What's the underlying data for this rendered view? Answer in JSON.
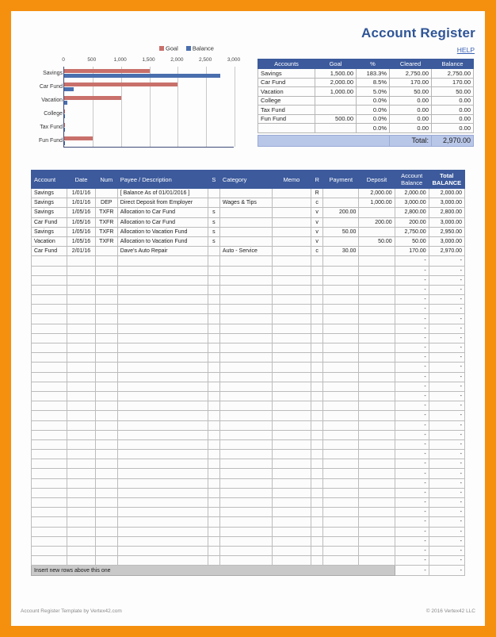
{
  "header": {
    "title": "Account Register",
    "help_label": "HELP",
    "accent": "#2f5597",
    "border_color": "#f5900f"
  },
  "chart_data": {
    "type": "bar",
    "orientation": "horizontal",
    "title": "",
    "xlabel": "",
    "ylabel": "",
    "categories": [
      "Savings",
      "Car Fund",
      "Vacation",
      "College",
      "Tax Fund",
      "Fun Fund"
    ],
    "series": [
      {
        "name": "Goal",
        "color": "#c9706b",
        "values": [
          1500,
          2000,
          1000,
          0,
          0,
          500
        ]
      },
      {
        "name": "Balance",
        "color": "#4a6fae",
        "values": [
          2750,
          170,
          50,
          0,
          0,
          0
        ]
      }
    ],
    "xlim": [
      0,
      3000
    ],
    "ticks": [
      "0",
      "500",
      "1,000",
      "1,500",
      "2,000",
      "2,500",
      "3,000"
    ],
    "tick_values": [
      0,
      500,
      1000,
      1500,
      2000,
      2500,
      3000
    ],
    "grid": true,
    "legend_position": "top-right"
  },
  "summary": {
    "columns": [
      "Accounts",
      "Goal",
      "%",
      "Cleared",
      "Balance"
    ],
    "rows": [
      {
        "account": "Savings",
        "goal": "1,500.00",
        "pct": "183.3%",
        "cleared": "2,750.00",
        "balance": "2,750.00"
      },
      {
        "account": "Car Fund",
        "goal": "2,000.00",
        "pct": "8.5%",
        "cleared": "170.00",
        "balance": "170.00"
      },
      {
        "account": "Vacation",
        "goal": "1,000.00",
        "pct": "5.0%",
        "cleared": "50.00",
        "balance": "50.00"
      },
      {
        "account": "College",
        "goal": "",
        "pct": "0.0%",
        "cleared": "0.00",
        "balance": "0.00"
      },
      {
        "account": "Tax Fund",
        "goal": "",
        "pct": "0.0%",
        "cleared": "0.00",
        "balance": "0.00"
      },
      {
        "account": "Fun Fund",
        "goal": "500.00",
        "pct": "0.0%",
        "cleared": "0.00",
        "balance": "0.00"
      },
      {
        "account": "",
        "goal": "",
        "pct": "0.0%",
        "cleared": "0.00",
        "balance": "0.00"
      }
    ],
    "total_label": "Total:",
    "total_value": "2,970.00"
  },
  "register": {
    "columns": [
      "Account",
      "Date",
      "Num",
      "Payee / Description",
      "S",
      "Category",
      "Memo",
      "R",
      "Payment",
      "Deposit",
      "Account Balance",
      "Total BALANCE"
    ],
    "column_headers": {
      "account": "Account",
      "date": "Date",
      "num": "Num",
      "payee": "Payee / Description",
      "s": "S",
      "category": "Category",
      "memo": "Memo",
      "r": "R",
      "payment": "Payment",
      "deposit": "Deposit",
      "acct_balance_line1": "Account",
      "acct_balance_line2": "Balance",
      "total_line1": "Total",
      "total_line2": "BALANCE"
    },
    "rows": [
      {
        "account": "Savings",
        "date": "1/01/16",
        "num": "",
        "payee": "[ Balance As of 01/01/2016 ]",
        "s": "",
        "category": "",
        "memo": "",
        "r": "R",
        "payment": "",
        "deposit": "2,000.00",
        "acct_balance": "2,000.00",
        "total_balance": "2,000.00"
      },
      {
        "account": "Savings",
        "date": "1/01/16",
        "num": "DEP",
        "payee": "Direct Deposit from Employer",
        "s": "",
        "category": "Wages & Tips",
        "memo": "",
        "r": "c",
        "payment": "",
        "deposit": "1,000.00",
        "acct_balance": "3,000.00",
        "total_balance": "3,000.00"
      },
      {
        "account": "Savings",
        "date": "1/05/16",
        "num": "TXFR",
        "payee": "Allocation to Car Fund",
        "s": "s",
        "category": "",
        "memo": "",
        "r": "v",
        "payment": "200.00",
        "deposit": "",
        "acct_balance": "2,800.00",
        "total_balance": "2,800.00"
      },
      {
        "account": "Car Fund",
        "date": "1/05/16",
        "num": "TXFR",
        "payee": "Allocation to Car Fund",
        "s": "s",
        "category": "",
        "memo": "",
        "r": "v",
        "payment": "",
        "deposit": "200.00",
        "acct_balance": "200.00",
        "total_balance": "3,000.00"
      },
      {
        "account": "Savings",
        "date": "1/05/16",
        "num": "TXFR",
        "payee": "Allocation to Vacation Fund",
        "s": "s",
        "category": "",
        "memo": "",
        "r": "v",
        "payment": "50.00",
        "deposit": "",
        "acct_balance": "2,750.00",
        "total_balance": "2,950.00"
      },
      {
        "account": "Vacation",
        "date": "1/05/16",
        "num": "TXFR",
        "payee": "Allocation to Vacation Fund",
        "s": "s",
        "category": "",
        "memo": "",
        "r": "v",
        "payment": "",
        "deposit": "50.00",
        "acct_balance": "50.00",
        "total_balance": "3,000.00"
      },
      {
        "account": "Car Fund",
        "date": "2/01/16",
        "num": "",
        "payee": "Dave's Auto Repair",
        "s": "",
        "category": "Auto - Service",
        "memo": "",
        "r": "c",
        "payment": "30.00",
        "deposit": "",
        "acct_balance": "170.00",
        "total_balance": "2,970.00"
      }
    ],
    "empty_row_count": 32,
    "empty_dash": "-",
    "insert_row_label": "Insert new rows above this one"
  },
  "footer": {
    "left": "Account Register Template by Vertex42.com",
    "right": "© 2016 Vertex42 LLC"
  }
}
